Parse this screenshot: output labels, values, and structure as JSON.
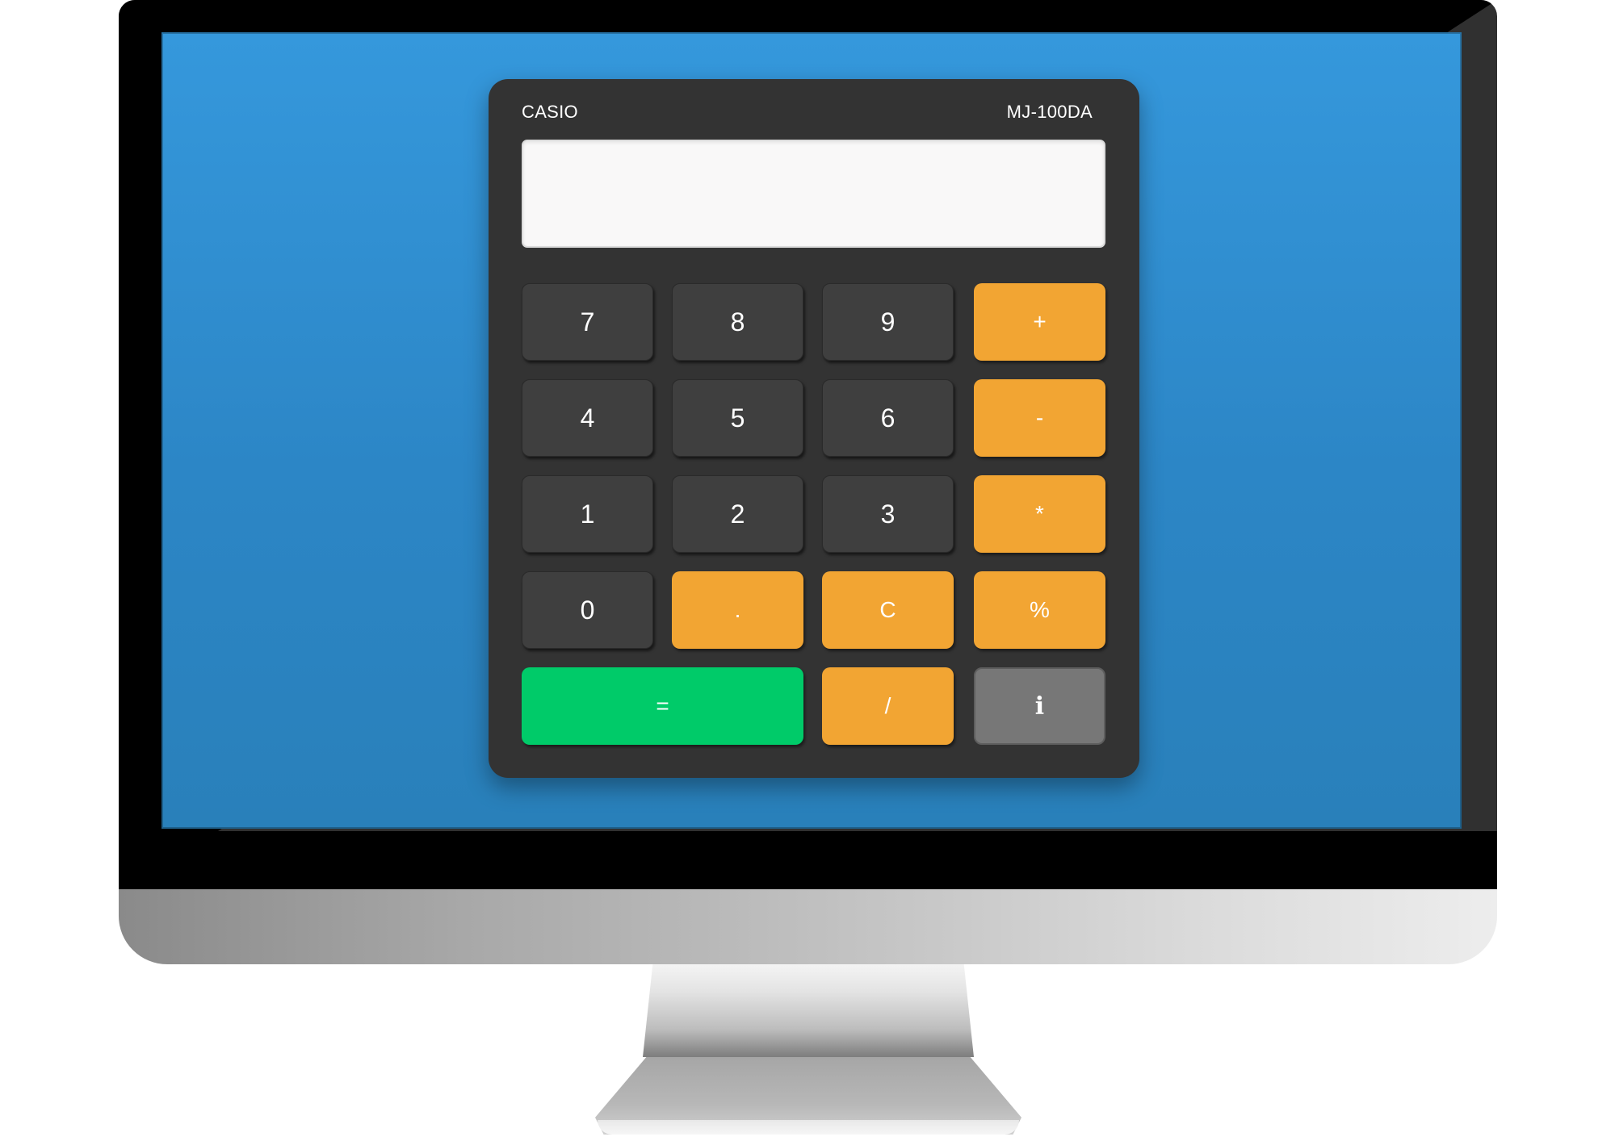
{
  "calculator": {
    "brand": "CASIO",
    "model": "MJ-100DA",
    "display_value": "",
    "keys": {
      "k7": "7",
      "k8": "8",
      "k9": "9",
      "plus": "+",
      "k4": "4",
      "k5": "5",
      "k6": "6",
      "minus": "-",
      "k1": "1",
      "k2": "2",
      "k3": "3",
      "multiply": "*",
      "k0": "0",
      "dot": ".",
      "clear": "C",
      "percent": "%",
      "equals": "=",
      "divide": "/",
      "info": "i"
    }
  },
  "colors": {
    "screen": "#3598dc",
    "body": "#333333",
    "number_key": "#3f3f3f",
    "operator_key": "#f2a533",
    "equals_key": "#00cb69",
    "info_key": "#777777",
    "display": "#f9f8f8"
  },
  "icons": {
    "info": "info-icon"
  }
}
